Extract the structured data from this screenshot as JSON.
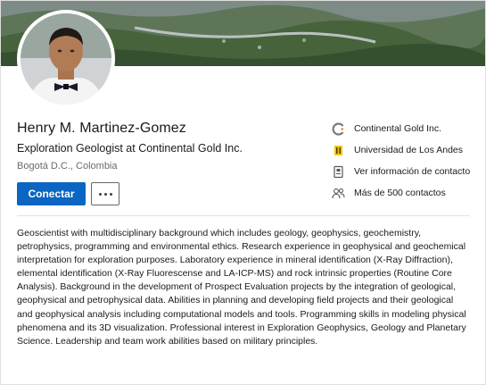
{
  "profile": {
    "name": "Henry M. Martinez-Gomez",
    "headline": "Exploration Geologist at Continental Gold Inc.",
    "location": "Bogotá D.C., Colombia"
  },
  "actions": {
    "connect_label": "Conectar",
    "more_icon": "ellipsis-icon"
  },
  "side": {
    "company": {
      "label": "Continental Gold Inc.",
      "icon": "company-logo-icon",
      "color": "#8a8a8a"
    },
    "school": {
      "label": "Universidad de Los Andes",
      "icon": "school-logo-icon",
      "color": "#f2c500"
    },
    "contact": {
      "label": "Ver información de contacto",
      "icon": "contact-card-icon"
    },
    "connections": {
      "label": "Más de 500 contactos",
      "icon": "people-icon"
    }
  },
  "summary": "Geoscientist with multidisciplinary background which includes geology, geophysics, geochemistry, petrophysics, programming and environmental ethics. Research experience in geophysical and geochemical interpretation for exploration purposes. Laboratory experience in mineral identification (X-Ray Diffraction), elemental identification (X-Ray Fluorescense and LA-ICP-MS) and rock intrinsic properties (Routine Core Analysis). Background in the development of Prospect Evaluation projects by the integration of geological, geophysical and petrophysical data. Abilities in planning and developing field projects and their geological and geophysical analysis including computational models and tools. Programming skills in modeling physical phenomena and its 3D visualization. Professional interest in Exploration Geophysics, Geology and Planetary Science. Leadership and team work abilities based on military principles.",
  "colors": {
    "primary": "#0a66c2",
    "secondary_text": "#666666"
  }
}
